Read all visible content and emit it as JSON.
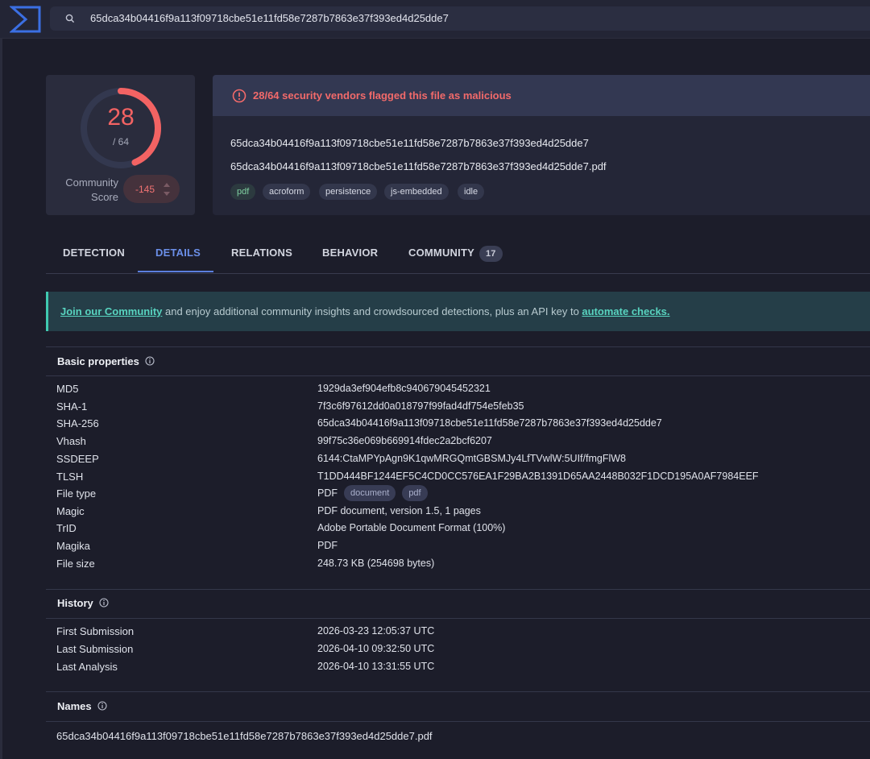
{
  "search": {
    "query": "65dca34b04416f9a113f09718cbe51e11fd58e7287b7863e37f393ed4d25dde7"
  },
  "score": {
    "detections": "28",
    "total": "/ 64",
    "fraction_flagged": 0.4375,
    "community_label_line1": "Community",
    "community_label_line2": "Score",
    "community_score": "-145"
  },
  "alert": {
    "text": "28/64 security vendors flagged this file as malicious"
  },
  "file": {
    "hash": "65dca34b04416f9a113f09718cbe51e11fd58e7287b7863e37f393ed4d25dde7",
    "name": "65dca34b04416f9a113f09718cbe51e11fd58e7287b7863e37f393ed4d25dde7.pdf",
    "tags": [
      "pdf",
      "acroform",
      "persistence",
      "js-embedded",
      "idle"
    ]
  },
  "tabs": [
    {
      "label": "DETECTION"
    },
    {
      "label": "DETAILS"
    },
    {
      "label": "RELATIONS"
    },
    {
      "label": "BEHAVIOR"
    },
    {
      "label": "COMMUNITY",
      "badge": "17"
    }
  ],
  "banner": {
    "link1": "Join our Community",
    "middle": " and enjoy additional community insights and crowdsourced detections, plus an API key to ",
    "link2": "automate checks."
  },
  "basic_properties": {
    "title": "Basic properties",
    "rows": [
      {
        "label": "MD5",
        "value": "1929da3ef904efb8c940679045452321"
      },
      {
        "label": "SHA-1",
        "value": "7f3c6f97612dd0a018797f99fad4df754e5feb35"
      },
      {
        "label": "SHA-256",
        "value": "65dca34b04416f9a113f09718cbe51e11fd58e7287b7863e37f393ed4d25dde7"
      },
      {
        "label": "Vhash",
        "value": "99f75c36e069b669914fdec2a2bcf6207"
      },
      {
        "label": "SSDEEP",
        "value": "6144:CtaMPYpAgn9K1qwMRGQmtGBSMJy4LfTVwlW:5UIf/fmgFlW8"
      },
      {
        "label": "TLSH",
        "value": "T1DD444BF1244EF5C4CD0CC576EA1F29BA2B1391D65AA2448B032F1DCD195A0AF7984EEF"
      },
      {
        "label": "File type",
        "value": "PDF",
        "chips": [
          "document",
          "pdf"
        ]
      },
      {
        "label": "Magic",
        "value": "PDF document, version 1.5, 1 pages"
      },
      {
        "label": "TrID",
        "value": "Adobe Portable Document Format (100%)"
      },
      {
        "label": "Magika",
        "value": "PDF"
      },
      {
        "label": "File size",
        "value": "248.73 KB (254698 bytes)"
      }
    ]
  },
  "history": {
    "title": "History",
    "rows": [
      {
        "label": "First Submission",
        "value": "2026-03-23 12:05:37 UTC"
      },
      {
        "label": "Last Submission",
        "value": "2026-04-10 09:32:50 UTC"
      },
      {
        "label": "Last Analysis",
        "value": "2026-04-10 13:31:55 UTC"
      }
    ]
  },
  "names": {
    "title": "Names",
    "items": [
      "65dca34b04416f9a113f09718cbe51e11fd58e7287b7863e37f393ed4d25dde7.pdf"
    ]
  },
  "colors": {
    "malicious": "#f36363",
    "accent": "#5b7fde",
    "community": "#40c9b0"
  }
}
